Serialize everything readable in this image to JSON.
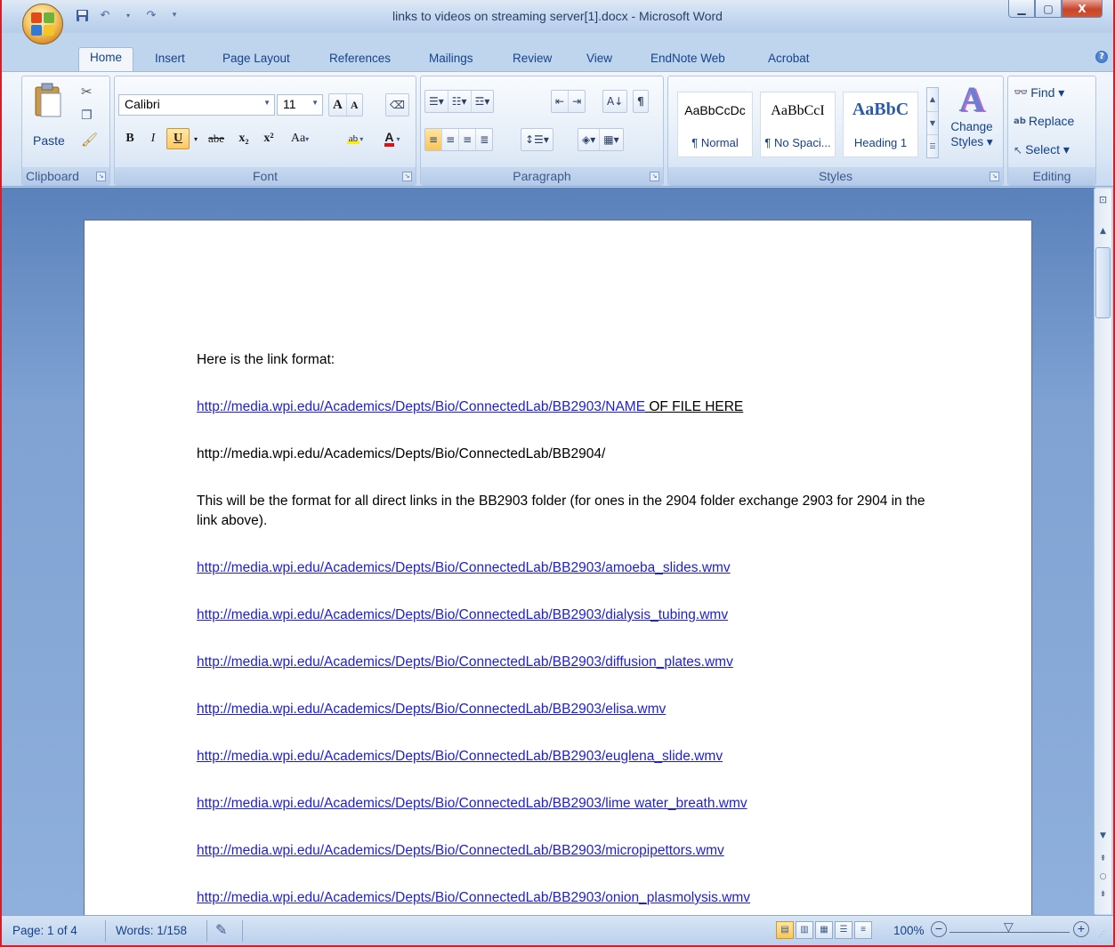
{
  "window": {
    "title": "links to videos on streaming server[1].docx - Microsoft Word",
    "controls": {
      "minimize": "–",
      "maximize": "□",
      "close": "X"
    }
  },
  "qat": {
    "save_icon": "save-icon",
    "undo_icon": "undo-icon",
    "redo_icon": "redo-icon",
    "customize_icon": "customize-qat-icon"
  },
  "tabs": [
    {
      "label": "Home"
    },
    {
      "label": "Insert"
    },
    {
      "label": "Page Layout"
    },
    {
      "label": "References"
    },
    {
      "label": "Mailings"
    },
    {
      "label": "Review"
    },
    {
      "label": "View"
    },
    {
      "label": "EndNote Web"
    },
    {
      "label": "Acrobat"
    }
  ],
  "ribbon": {
    "clipboard": {
      "label": "Clipboard",
      "paste": "Paste"
    },
    "font": {
      "label": "Font",
      "name": "Calibri",
      "size": "11",
      "bold": "B",
      "italic": "I",
      "underline": "U",
      "strike": "abe",
      "subscript": "x₂",
      "superscript": "x²",
      "case": "Aa",
      "grow": "A",
      "shrink": "A"
    },
    "paragraph": {
      "label": "Paragraph"
    },
    "styles": {
      "label": "Styles",
      "tiles": [
        {
          "preview": "AaBbCcDc",
          "name": "¶ Normal"
        },
        {
          "preview": "AaBbCcI",
          "name": "¶ No Spaci..."
        },
        {
          "preview": "AaBbC",
          "name": "Heading 1"
        }
      ],
      "change_styles": "Change Styles ▾"
    },
    "editing": {
      "label": "Editing",
      "find": "Find ▾",
      "replace": "Replace",
      "select": "Select ▾"
    }
  },
  "document": {
    "intro": "Here is the link format:",
    "link_format_url": "http://media.wpi.edu/Academics/Depts/Bio/ConnectedLab/BB2903/NAME",
    "link_format_suffix": " OF FILE HERE",
    "folder_2904": "http://media.wpi.edu/Academics/Depts/Bio/ConnectedLab/BB2904/",
    "note": "This will be the format for all direct links in the BB2903  folder (for ones in the 2904  folder exchange 2903 for 2904  in the link above).",
    "links": [
      "http://media.wpi.edu/Academics/Depts/Bio/ConnectedLab/BB2903/amoeba_slides.wmv",
      "http://media.wpi.edu/Academics/Depts/Bio/ConnectedLab/BB2903/dialysis_tubing.wmv",
      "http://media.wpi.edu/Academics/Depts/Bio/ConnectedLab/BB2903/diffusion_plates.wmv",
      "http://media.wpi.edu/Academics/Depts/Bio/ConnectedLab/BB2903/elisa.wmv",
      "http://media.wpi.edu/Academics/Depts/Bio/ConnectedLab/BB2903/euglena_slide.wmv",
      "http://media.wpi.edu/Academics/Depts/Bio/ConnectedLab/BB2903/lime water_breath.wmv",
      "http://media.wpi.edu/Academics/Depts/Bio/ConnectedLab/BB2903/micropipettors.wmv",
      "http://media.wpi.edu/Academics/Depts/Bio/ConnectedLab/BB2903/onion_plasmolysis.wmv"
    ]
  },
  "status": {
    "page": "Page: 1 of 4",
    "words": "Words: 1/158",
    "zoom": "100%"
  },
  "colors": {
    "accent": "#15428b",
    "link": "#1f1fd0",
    "window_border": "#d0202a"
  }
}
